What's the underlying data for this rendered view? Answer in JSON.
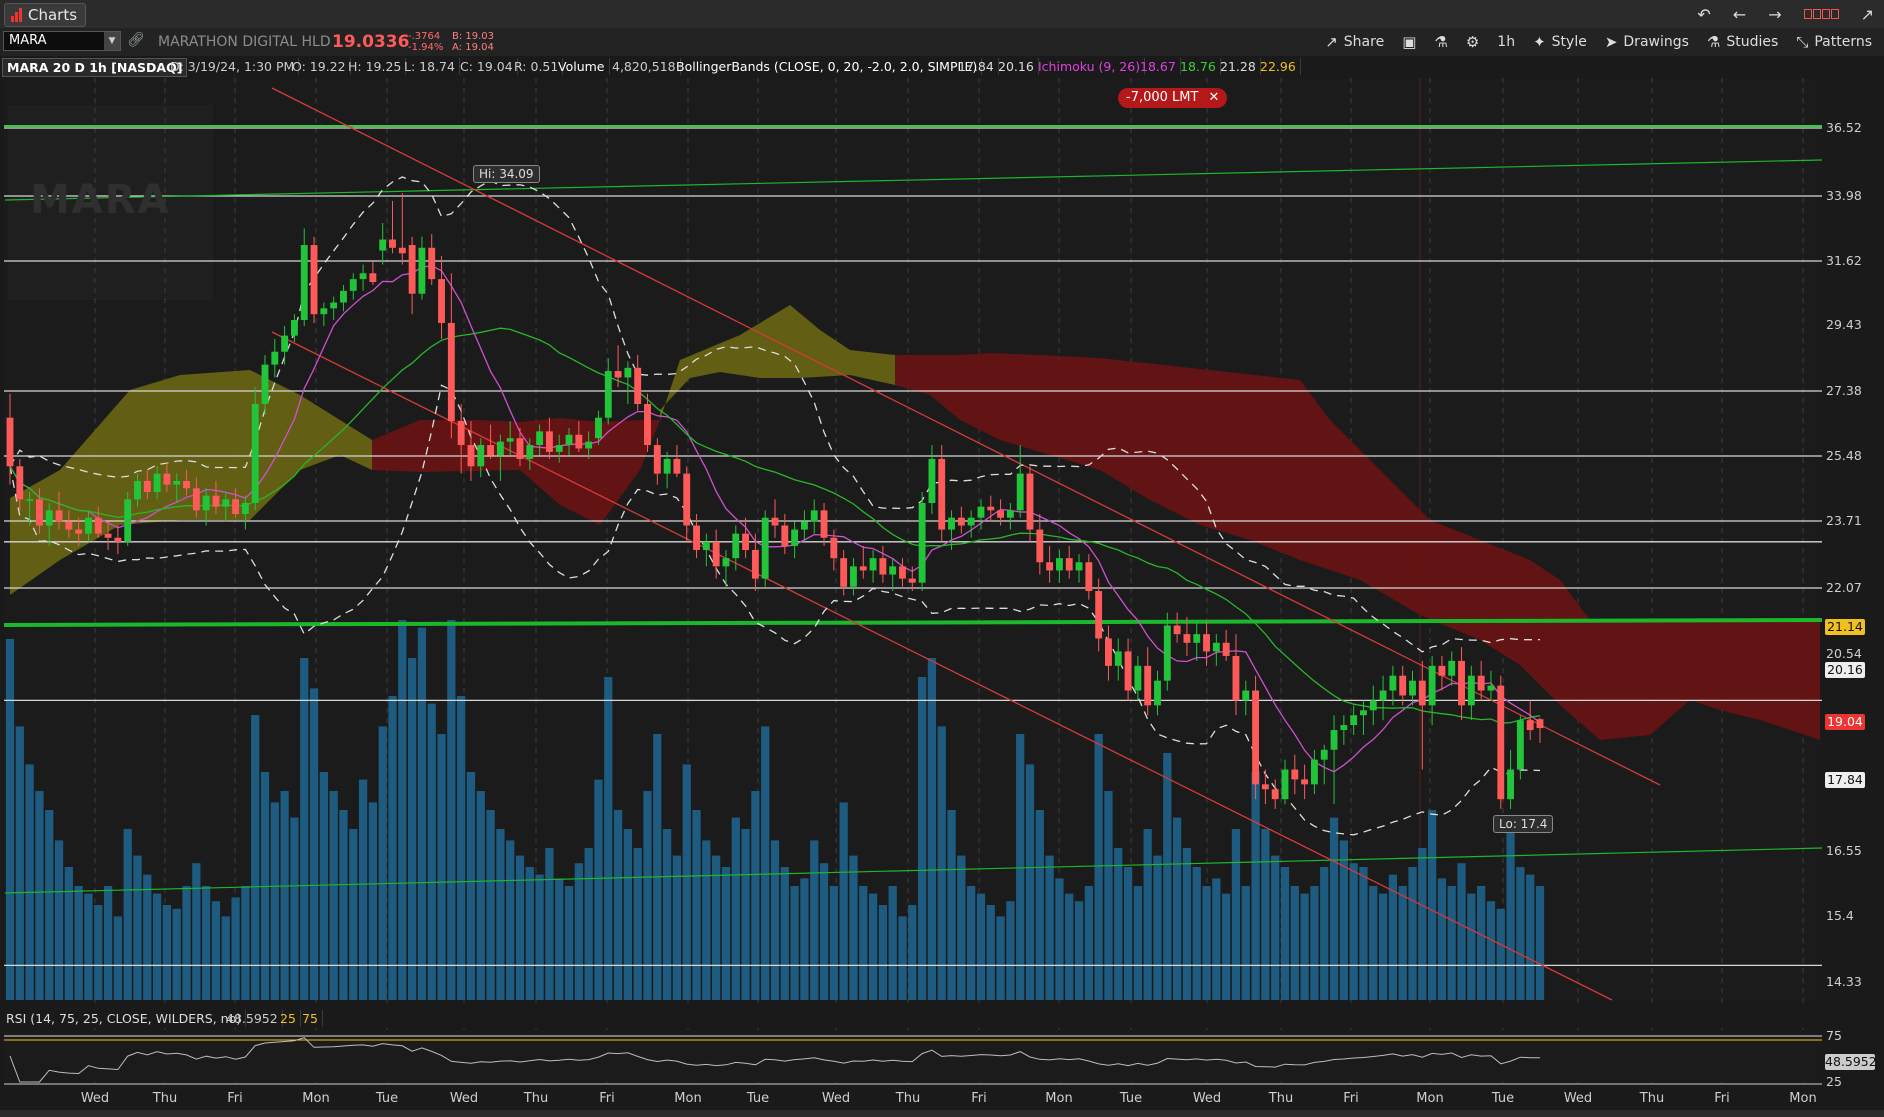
{
  "window": {
    "app_tab_label": "Charts",
    "bars_icon": "chart-bars-icon",
    "controls": [
      "undo-icon",
      "back-icon",
      "forward-icon",
      "layout-tiles-icon",
      "pin-icon"
    ]
  },
  "toolbar": {
    "symbol": "MARA",
    "company": "MARATHON DIGITAL HLD",
    "last_price": "19.0336",
    "change_net": "-.3764",
    "change_pct": "-1.94%",
    "bid": "B: 19.03",
    "ask": "A: 19.04",
    "share_label": "Share",
    "timeframe_label": "1h",
    "style_label": "Style",
    "drawings_label": "Drawings",
    "studies_label": "Studies",
    "patterns_label": "Patterns"
  },
  "study_bar": {
    "header": "MARA 20 D 1h [NASDAQ]",
    "date": "D: 3/19/24, 1:30 PM",
    "open": "O: 19.22",
    "high": "H: 19.25",
    "low": "L: 18.74",
    "close": "C: 19.04",
    "range": "R: 0.51",
    "volume_label": "Volume",
    "volume_value": "4,820,518",
    "bb_label": "BollingerBands (CLOSE, 0, 20, -2.0, 2.0, SIMPLE)",
    "bb_lower": "17.84",
    "bb_upper": "20.16",
    "ichimoku_label": "Ichimoku (9, 26)",
    "ichi_1": "18.67",
    "ichi_2": "18.76",
    "ichi_3": "21.28",
    "ichi_4": "22.96"
  },
  "annotations": {
    "order_label": "-7,000 LMT",
    "hi_label": "Hi: 34.09",
    "lo_label": "Lo: 17.4",
    "watermark": "MARA"
  },
  "price_tags": {
    "green_line": "21.14",
    "bb_upper": "20.16",
    "last": "19.04",
    "bb_lower": "17.84",
    "rsi": "48.5952"
  },
  "rsi_bar": {
    "label": "RSI (14, 75, 25, CLOSE, WILDERS, no)",
    "value": "48.5952",
    "low": "25",
    "high": "75"
  },
  "rsi_axis": [
    "75",
    "25"
  ],
  "colors": {
    "up": "#22c43a",
    "down": "#ff5a5a",
    "volume": "#1d5c80",
    "cloud_bull": "#6e6a12",
    "cloud_bear": "#6e1212",
    "trend_red": "#d63a3a",
    "trend_green": "#1cb82c"
  },
  "chart_data": {
    "type": "candlestick",
    "symbol": "MARA",
    "timeframe": "1h",
    "price_axis_ticks": [
      36.52,
      33.98,
      31.62,
      29.43,
      27.38,
      25.48,
      23.71,
      22.07,
      20.54,
      16.55,
      15.4,
      14.33
    ],
    "x_labels": [
      "Wed",
      "Thu",
      "Fri",
      "Mon",
      "Tue",
      "Wed",
      "Thu",
      "Fri",
      "Mon",
      "Tue",
      "Wed",
      "Thu",
      "Fri",
      "Mon",
      "Tue",
      "Wed",
      "Thu",
      "Fri",
      "Mon",
      "Tue",
      "Wed",
      "Thu",
      "Fri",
      "Mon"
    ],
    "horizontal_levels": [
      36.52,
      33.98,
      31.62,
      27.38,
      25.48,
      23.71,
      23.2,
      22.07,
      19.6,
      14.6
    ],
    "support_line": 21.14,
    "candles": [
      [
        26.6,
        27.3,
        24.7,
        25.2
      ],
      [
        25.2,
        25.4,
        24.0,
        24.3
      ],
      [
        24.3,
        24.5,
        23.6,
        24.3
      ],
      [
        24.3,
        24.6,
        23.4,
        23.6
      ],
      [
        23.6,
        24.2,
        23.1,
        24.0
      ],
      [
        24.0,
        24.5,
        23.5,
        23.7
      ],
      [
        23.7,
        24.0,
        23.3,
        23.5
      ],
      [
        23.5,
        23.8,
        23.1,
        23.4
      ],
      [
        23.4,
        24.0,
        23.2,
        23.8
      ],
      [
        23.8,
        24.1,
        23.3,
        23.4
      ],
      [
        23.4,
        23.7,
        23.0,
        23.3
      ],
      [
        23.3,
        23.6,
        22.9,
        23.2
      ],
      [
        23.2,
        24.5,
        23.1,
        24.3
      ],
      [
        24.3,
        25.0,
        24.1,
        24.8
      ],
      [
        24.8,
        25.1,
        24.3,
        24.5
      ],
      [
        24.5,
        25.2,
        24.3,
        25.0
      ],
      [
        25.0,
        25.3,
        24.5,
        24.7
      ],
      [
        24.7,
        25.0,
        24.2,
        24.8
      ],
      [
        24.8,
        25.1,
        24.4,
        24.6
      ],
      [
        24.6,
        24.9,
        23.8,
        24.0
      ],
      [
        24.0,
        24.6,
        23.6,
        24.4
      ],
      [
        24.4,
        24.8,
        23.9,
        24.1
      ],
      [
        24.1,
        24.5,
        23.7,
        24.3
      ],
      [
        24.3,
        24.6,
        23.8,
        23.9
      ],
      [
        23.9,
        24.4,
        23.5,
        24.2
      ],
      [
        24.2,
        27.5,
        24.0,
        27.0
      ],
      [
        27.0,
        28.5,
        26.7,
        28.2
      ],
      [
        28.2,
        29.0,
        27.8,
        28.6
      ],
      [
        28.6,
        29.4,
        28.2,
        29.1
      ],
      [
        29.1,
        29.8,
        28.9,
        29.6
      ],
      [
        29.6,
        32.8,
        29.4,
        32.2
      ],
      [
        32.2,
        32.5,
        29.5,
        29.8
      ],
      [
        29.8,
        30.2,
        29.4,
        30.0
      ],
      [
        30.0,
        30.4,
        29.6,
        30.2
      ],
      [
        30.2,
        30.8,
        29.9,
        30.6
      ],
      [
        30.6,
        31.2,
        30.3,
        31.0
      ],
      [
        31.0,
        31.5,
        30.6,
        31.2
      ],
      [
        31.2,
        31.6,
        30.8,
        30.9
      ],
      [
        32.0,
        33.0,
        31.5,
        32.4
      ],
      [
        32.4,
        33.8,
        31.9,
        32.1
      ],
      [
        32.1,
        34.09,
        31.5,
        31.9
      ],
      [
        32.2,
        32.5,
        29.8,
        30.5
      ],
      [
        30.5,
        32.5,
        30.3,
        32.1
      ],
      [
        32.1,
        32.6,
        30.8,
        31.0
      ],
      [
        31.0,
        31.8,
        29.0,
        29.5
      ],
      [
        29.5,
        31.2,
        26.0,
        26.5
      ],
      [
        26.5,
        27.0,
        25.0,
        25.8
      ],
      [
        25.8,
        26.5,
        24.8,
        25.2
      ],
      [
        25.2,
        26.0,
        24.9,
        25.8
      ],
      [
        25.8,
        26.4,
        25.4,
        25.5
      ],
      [
        25.5,
        26.1,
        24.8,
        25.9
      ],
      [
        25.9,
        26.5,
        25.5,
        26.0
      ],
      [
        26.0,
        26.3,
        25.2,
        25.4
      ],
      [
        25.4,
        26.0,
        25.1,
        25.8
      ],
      [
        25.8,
        26.4,
        25.5,
        26.2
      ],
      [
        26.2,
        26.6,
        25.4,
        25.6
      ],
      [
        25.6,
        26.1,
        25.3,
        25.8
      ],
      [
        25.8,
        26.3,
        25.5,
        26.1
      ],
      [
        26.1,
        26.5,
        25.6,
        25.7
      ],
      [
        25.7,
        26.2,
        25.4,
        25.9
      ],
      [
        26.0,
        26.8,
        25.8,
        26.6
      ],
      [
        26.6,
        28.4,
        26.4,
        28.0
      ],
      [
        28.0,
        28.8,
        27.5,
        27.8
      ],
      [
        27.8,
        28.3,
        27.0,
        28.1
      ],
      [
        28.1,
        28.5,
        26.8,
        27.0
      ],
      [
        27.0,
        27.3,
        25.6,
        25.8
      ],
      [
        25.8,
        26.0,
        24.7,
        25.0
      ],
      [
        25.0,
        25.6,
        24.6,
        25.4
      ],
      [
        25.4,
        25.8,
        24.9,
        25.0
      ],
      [
        25.0,
        25.2,
        23.2,
        23.6
      ],
      [
        23.6,
        23.9,
        22.8,
        23.0
      ],
      [
        23.0,
        23.4,
        22.6,
        23.2
      ],
      [
        23.2,
        23.5,
        22.3,
        22.6
      ],
      [
        22.6,
        23.0,
        22.1,
        22.8
      ],
      [
        22.8,
        23.6,
        22.5,
        23.4
      ],
      [
        23.4,
        23.8,
        22.8,
        23.0
      ],
      [
        23.0,
        23.4,
        22.0,
        22.3
      ],
      [
        22.3,
        24.0,
        22.1,
        23.8
      ],
      [
        23.8,
        24.3,
        23.3,
        23.6
      ],
      [
        23.6,
        23.9,
        22.9,
        23.1
      ],
      [
        23.1,
        23.7,
        22.8,
        23.5
      ],
      [
        23.5,
        24.0,
        23.2,
        23.7
      ],
      [
        23.7,
        24.3,
        23.4,
        24.0
      ],
      [
        24.0,
        24.2,
        23.1,
        23.3
      ],
      [
        23.3,
        23.5,
        22.5,
        22.8
      ],
      [
        22.8,
        23.0,
        21.9,
        22.1
      ],
      [
        22.1,
        22.8,
        21.9,
        22.6
      ],
      [
        22.6,
        23.1,
        22.3,
        22.5
      ],
      [
        22.5,
        23.0,
        22.2,
        22.8
      ],
      [
        22.8,
        23.1,
        22.2,
        22.4
      ],
      [
        22.4,
        22.8,
        22.0,
        22.6
      ],
      [
        22.6,
        22.8,
        22.1,
        22.3
      ],
      [
        22.3,
        22.6,
        22.0,
        22.2
      ],
      [
        22.2,
        24.5,
        22.0,
        24.2
      ],
      [
        24.2,
        25.8,
        23.9,
        25.4
      ],
      [
        25.4,
        25.8,
        23.2,
        23.5
      ],
      [
        23.5,
        24.0,
        23.0,
        23.8
      ],
      [
        23.8,
        24.1,
        23.4,
        23.6
      ],
      [
        23.6,
        24.0,
        23.3,
        23.8
      ],
      [
        23.8,
        24.3,
        23.5,
        24.1
      ],
      [
        24.1,
        24.4,
        23.7,
        24.0
      ],
      [
        24.0,
        24.3,
        23.6,
        23.8
      ],
      [
        23.8,
        24.2,
        23.5,
        24.0
      ],
      [
        24.0,
        25.8,
        23.8,
        25.0
      ],
      [
        25.0,
        25.2,
        23.2,
        23.5
      ],
      [
        23.5,
        23.9,
        22.4,
        22.7
      ],
      [
        22.7,
        23.1,
        22.2,
        22.5
      ],
      [
        22.5,
        23.0,
        22.2,
        22.8
      ],
      [
        22.8,
        23.1,
        22.3,
        22.5
      ],
      [
        22.5,
        22.9,
        22.2,
        22.7
      ],
      [
        22.7,
        22.9,
        21.8,
        22.0
      ],
      [
        22.0,
        22.3,
        20.6,
        20.9
      ],
      [
        20.9,
        21.2,
        20.0,
        20.3
      ],
      [
        20.3,
        20.9,
        20.0,
        20.6
      ],
      [
        20.6,
        20.9,
        19.6,
        19.8
      ],
      [
        19.8,
        20.5,
        19.6,
        20.3
      ],
      [
        20.3,
        20.7,
        19.3,
        19.5
      ],
      [
        19.5,
        20.2,
        19.3,
        20.0
      ],
      [
        20.0,
        21.5,
        19.8,
        21.2
      ],
      [
        21.2,
        21.5,
        20.8,
        21.0
      ],
      [
        21.0,
        21.4,
        20.5,
        20.8
      ],
      [
        20.8,
        21.3,
        20.4,
        21.0
      ],
      [
        21.0,
        21.3,
        20.3,
        20.6
      ],
      [
        20.6,
        21.0,
        20.3,
        20.8
      ],
      [
        20.8,
        21.1,
        20.4,
        20.5
      ],
      [
        20.5,
        21.0,
        19.3,
        19.6
      ],
      [
        19.6,
        20.0,
        19.3,
        19.8
      ],
      [
        19.8,
        20.1,
        17.6,
        17.9
      ],
      [
        17.9,
        18.2,
        17.5,
        17.8
      ],
      [
        17.8,
        18.0,
        17.4,
        17.6
      ],
      [
        17.6,
        18.4,
        17.5,
        18.2
      ],
      [
        18.2,
        18.5,
        17.7,
        18.0
      ],
      [
        18.0,
        18.3,
        17.6,
        17.9
      ],
      [
        17.9,
        18.6,
        17.7,
        18.4
      ],
      [
        18.4,
        18.7,
        17.9,
        18.6
      ],
      [
        18.6,
        19.3,
        17.5,
        19.0
      ],
      [
        19.0,
        19.3,
        18.7,
        19.1
      ],
      [
        19.1,
        19.5,
        18.9,
        19.3
      ],
      [
        19.3,
        19.6,
        18.9,
        19.4
      ],
      [
        19.4,
        19.9,
        19.1,
        19.6
      ],
      [
        19.6,
        20.1,
        19.2,
        19.8
      ],
      [
        19.8,
        20.3,
        19.5,
        20.1
      ],
      [
        20.1,
        20.3,
        19.5,
        19.7
      ],
      [
        19.7,
        20.2,
        19.5,
        20.0
      ],
      [
        20.0,
        20.4,
        18.2,
        19.5
      ],
      [
        19.5,
        20.5,
        19.1,
        20.3
      ],
      [
        20.3,
        20.5,
        19.8,
        20.1
      ],
      [
        20.1,
        20.6,
        19.9,
        20.4
      ],
      [
        20.4,
        20.7,
        19.2,
        19.5
      ],
      [
        19.5,
        20.3,
        19.2,
        20.1
      ],
      [
        20.1,
        20.4,
        19.6,
        19.8
      ],
      [
        19.8,
        20.2,
        19.6,
        19.9
      ],
      [
        19.9,
        20.1,
        17.4,
        17.6
      ],
      [
        17.6,
        18.6,
        17.4,
        18.2
      ],
      [
        18.2,
        19.3,
        18.0,
        19.2
      ],
      [
        19.2,
        19.6,
        18.8,
        19.0
      ],
      [
        19.22,
        19.25,
        18.74,
        19.04
      ]
    ],
    "volume_max": 5000000,
    "rsi": {
      "value": 48.5952,
      "high": 75,
      "low": 25
    },
    "hi": 34.09,
    "lo": 17.4
  }
}
